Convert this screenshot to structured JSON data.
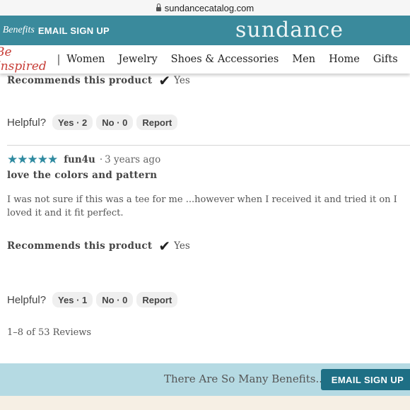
{
  "browser": {
    "url": "sundancecatalog.com"
  },
  "top_banner": {
    "benefits_text": "e Benefits",
    "signup_label": "EMAIL SIGN UP",
    "logo": "sundance"
  },
  "nav": {
    "tagline": "Be Inspired",
    "separator": "|",
    "items": [
      "Women",
      "Jewelry",
      "Shoes & Accessories",
      "Men",
      "Home",
      "Gifts"
    ]
  },
  "review_prev": {
    "recommends_label": "Recommends this product",
    "recommends_value": "Yes",
    "helpful_label": "Helpful?",
    "yes_button": "Yes · 2",
    "no_button": "No · 0",
    "report_button": "Report"
  },
  "review": {
    "stars": "★★★★★",
    "rating": 5,
    "author": "fun4u",
    "separator": "·",
    "age": "3 years ago",
    "title": "love the colors and pattern",
    "body": "I was not sure if this was a tee for me ...however when I received it and tried it on I loved it and it fit perfect.",
    "recommends_label": "Recommends this product",
    "recommends_value": "Yes",
    "helpful_label": "Helpful?",
    "yes_button": "Yes · 1",
    "no_button": "No · 0",
    "report_button": "Report"
  },
  "pagination": {
    "count_text": "1–8 of 53 Reviews"
  },
  "bottom_banner": {
    "text": "There Are So Many Benefits...",
    "button": "EMAIL SIGN UP"
  },
  "colors": {
    "teal_banner": "#3a8a9c",
    "light_banner": "#b5dae3",
    "button": "#1e6f85",
    "star": "#2f8aa0",
    "tagline": "#c8403a"
  }
}
